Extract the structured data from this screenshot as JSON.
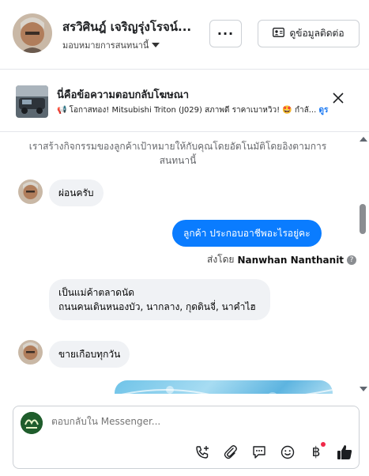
{
  "header": {
    "name": "สรวิศินฎ์ เจริญรุ่งโรจน์...",
    "assignment": "มอบหมายการสนทนานี้",
    "more_label": "···",
    "contact_label": "ดูข้อมูลติดต่อ"
  },
  "ad": {
    "title": "นี่คือข้อความตอบกลับโฆษณา",
    "text": "📢 โอกาสทอง! Mitsubishi Triton (J029) สภาพดี ราคาเบาหวิว! 🤩 กำลั...",
    "link": "ดูร"
  },
  "chat": {
    "notice": "เราสร้างกิจกรรมของลูกค้าเป้าหมายให้กับคุณโดยอัตโนมัติโดยอิงตามการสนทนานี้",
    "messages": [
      {
        "text": "ผ่อนครับ"
      },
      {
        "text": "ลูกค้า  ประกอบอาชีพอะไรอยู่คะ"
      },
      {
        "text": "เป็นแม่ค้าตลาดนัด\nถนนคนเดินหนองบัว, นากลาง, กุดดินจี่, นาคำไฮ"
      },
      {
        "text": "ขายเกือบทุกวัน"
      }
    ],
    "sent_by_prefix": "ส่งโดย",
    "sent_by_name": "Nanwhan Nanthanit",
    "help_icon": "?"
  },
  "composer": {
    "placeholder": "ตอบกลับใน Messenger...",
    "baht": "฿"
  },
  "colors": {
    "accent": "#0a7cff",
    "incoming_bubble": "#f0f2f5",
    "notification": "#f02849"
  }
}
